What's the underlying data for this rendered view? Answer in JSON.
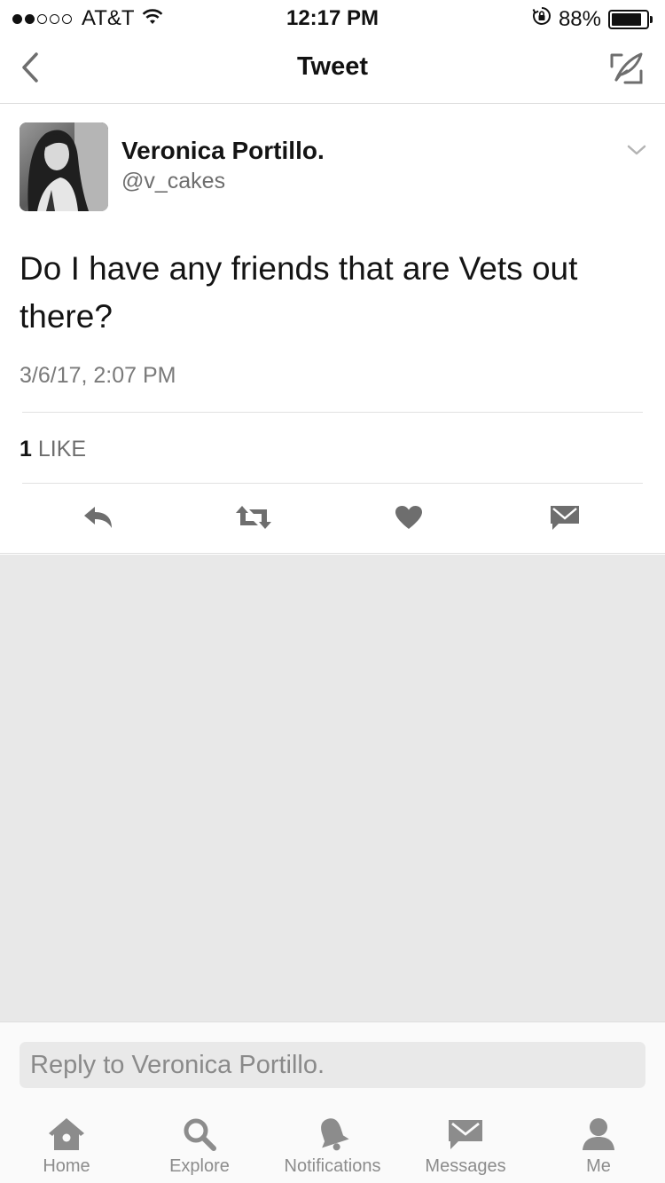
{
  "status_bar": {
    "carrier": "AT&T",
    "signal_bars": 2,
    "signal_total": 5,
    "time": "12:17 PM",
    "battery_percent": "88%",
    "battery_level": 0.88,
    "icons": [
      "wifi-icon",
      "rotation-lock-icon",
      "battery-icon"
    ]
  },
  "nav": {
    "title": "Tweet",
    "left_icon": "back-chevron-icon",
    "right_icon": "compose-tweet-icon"
  },
  "tweet": {
    "author_name": "Veronica Portillo.",
    "author_handle": "@v_cakes",
    "text": "Do I have any friends that are Vets out there?",
    "date": "3/6/17, 2:07 PM",
    "like_count": "1",
    "like_label": "LIKE",
    "actions": [
      {
        "name": "reply",
        "icon": "reply-icon"
      },
      {
        "name": "retweet",
        "icon": "retweet-icon"
      },
      {
        "name": "like",
        "icon": "heart-icon"
      },
      {
        "name": "message",
        "icon": "envelope-icon"
      }
    ]
  },
  "reply": {
    "placeholder": "Reply to Veronica Portillo."
  },
  "tabs": [
    {
      "label": "Home",
      "icon": "home-icon"
    },
    {
      "label": "Explore",
      "icon": "search-icon"
    },
    {
      "label": "Notifications",
      "icon": "bell-icon"
    },
    {
      "label": "Messages",
      "icon": "envelope-icon"
    },
    {
      "label": "Me",
      "icon": "person-icon"
    }
  ],
  "colors": {
    "text_primary": "#141414",
    "text_secondary": "#6e6e6e",
    "icon_gray": "#7a7a7a",
    "empty_area": "#e8e8e8"
  }
}
